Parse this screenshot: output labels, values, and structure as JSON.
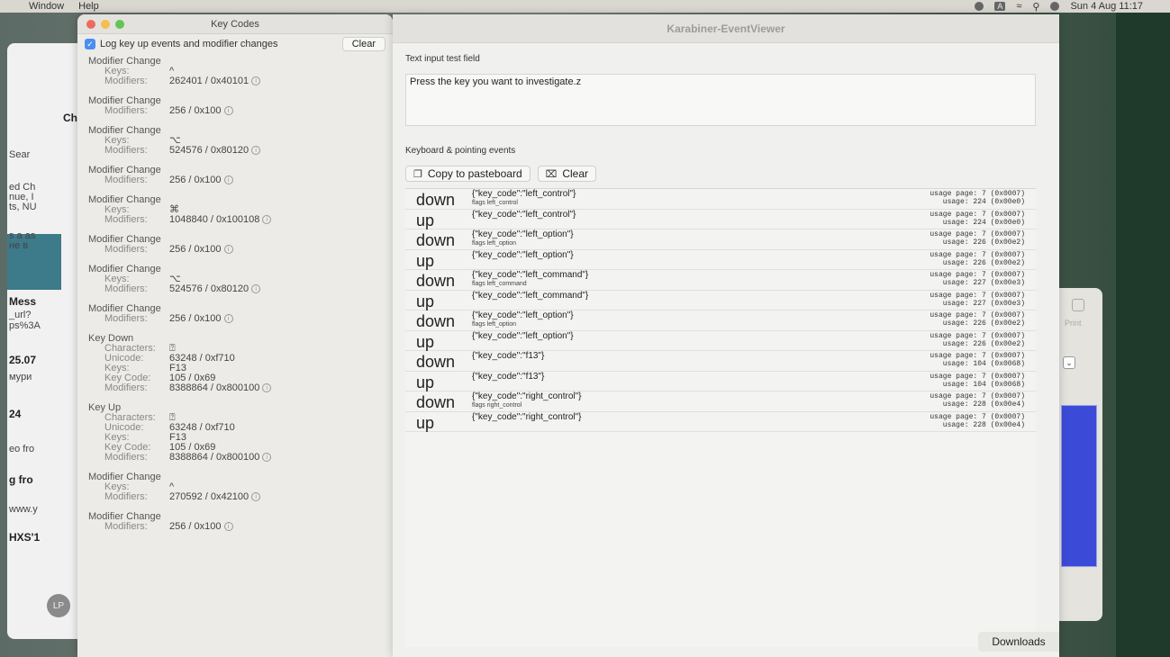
{
  "menubar": {
    "items": [
      "Window",
      "Help"
    ],
    "status_badge": "A",
    "datetime": "Sun 4 Aug 11:17"
  },
  "background_window": {
    "lines": [
      "Ch",
      "Sear",
      "ed Ch",
      "nue, I",
      "ts, NU",
      "s a as",
      "не в",
      "Mess",
      "_url?",
      "ps%3A",
      "25.07",
      "мури",
      "24",
      "eo fro",
      "g fro",
      "www.y",
      "HXS'1"
    ],
    "avatar": "LP"
  },
  "print_dialog": {
    "label": "Print"
  },
  "keycodes": {
    "title": "Key Codes",
    "log_checkbox_label": "Log key up events and modifier changes",
    "clear_label": "Clear",
    "entries": [
      {
        "title": "Modifier Change",
        "rows": [
          {
            "k": "Keys:",
            "v": "^"
          },
          {
            "k": "Modifiers:",
            "v": "262401 / 0x40101",
            "info": true
          }
        ]
      },
      {
        "title": "Modifier Change",
        "rows": [
          {
            "k": "Modifiers:",
            "v": "256 / 0x100",
            "info": true
          }
        ]
      },
      {
        "title": "Modifier Change",
        "rows": [
          {
            "k": "Keys:",
            "v": "⌥"
          },
          {
            "k": "Modifiers:",
            "v": "524576 / 0x80120",
            "info": true
          }
        ]
      },
      {
        "title": "Modifier Change",
        "rows": [
          {
            "k": "Modifiers:",
            "v": "256 / 0x100",
            "info": true
          }
        ]
      },
      {
        "title": "Modifier Change",
        "rows": [
          {
            "k": "Keys:",
            "v": "⌘"
          },
          {
            "k": "Modifiers:",
            "v": "1048840 / 0x100108",
            "info": true
          }
        ]
      },
      {
        "title": "Modifier Change",
        "rows": [
          {
            "k": "Modifiers:",
            "v": "256 / 0x100",
            "info": true
          }
        ]
      },
      {
        "title": "Modifier Change",
        "rows": [
          {
            "k": "Keys:",
            "v": "⌥"
          },
          {
            "k": "Modifiers:",
            "v": "524576 / 0x80120",
            "info": true
          }
        ]
      },
      {
        "title": "Modifier Change",
        "rows": [
          {
            "k": "Modifiers:",
            "v": "256 / 0x100",
            "info": true
          }
        ]
      },
      {
        "title": "Key Down",
        "rows": [
          {
            "k": "Characters:",
            "v": "⍰"
          },
          {
            "k": "Unicode:",
            "v": "63248 / 0xf710"
          },
          {
            "k": "Keys:",
            "v": "F13"
          },
          {
            "k": "Key Code:",
            "v": "105 / 0x69"
          },
          {
            "k": "Modifiers:",
            "v": "8388864 / 0x800100",
            "info": true
          }
        ]
      },
      {
        "title": "Key Up",
        "rows": [
          {
            "k": "Characters:",
            "v": "⍰"
          },
          {
            "k": "Unicode:",
            "v": "63248 / 0xf710"
          },
          {
            "k": "Keys:",
            "v": "F13"
          },
          {
            "k": "Key Code:",
            "v": "105 / 0x69"
          },
          {
            "k": "Modifiers:",
            "v": "8388864 / 0x800100",
            "info": true
          }
        ]
      },
      {
        "title": "Modifier Change",
        "rows": [
          {
            "k": "Keys:",
            "v": "^"
          },
          {
            "k": "Modifiers:",
            "v": "270592 / 0x42100",
            "info": true
          }
        ]
      },
      {
        "title": "Modifier Change",
        "rows": [
          {
            "k": "Modifiers:",
            "v": "256 / 0x100",
            "info": true
          }
        ]
      }
    ]
  },
  "viewer": {
    "title": "Karabiner-EventViewer",
    "text_input_label": "Text input test field",
    "text_input_value": "Press the key you want to investigate.z",
    "events_label": "Keyboard & pointing events",
    "copy_label": "Copy to pasteboard",
    "clear_label": "Clear",
    "events": [
      {
        "type": "down",
        "code": "{\"key_code\":\"left_control\"}",
        "flags": "flags left_control",
        "usage_page": "usage page: 7  (0x0007)",
        "usage": "usage: 224  (0x00e0)"
      },
      {
        "type": "up",
        "code": "{\"key_code\":\"left_control\"}",
        "flags": "",
        "usage_page": "usage page: 7  (0x0007)",
        "usage": "usage: 224  (0x00e0)"
      },
      {
        "type": "down",
        "code": "{\"key_code\":\"left_option\"}",
        "flags": "flags left_option",
        "usage_page": "usage page: 7  (0x0007)",
        "usage": "usage: 226  (0x00e2)"
      },
      {
        "type": "up",
        "code": "{\"key_code\":\"left_option\"}",
        "flags": "",
        "usage_page": "usage page: 7  (0x0007)",
        "usage": "usage: 226  (0x00e2)"
      },
      {
        "type": "down",
        "code": "{\"key_code\":\"left_command\"}",
        "flags": "flags left_command",
        "usage_page": "usage page: 7  (0x0007)",
        "usage": "usage: 227  (0x00e3)"
      },
      {
        "type": "up",
        "code": "{\"key_code\":\"left_command\"}",
        "flags": "",
        "usage_page": "usage page: 7  (0x0007)",
        "usage": "usage: 227  (0x00e3)"
      },
      {
        "type": "down",
        "code": "{\"key_code\":\"left_option\"}",
        "flags": "flags left_option",
        "usage_page": "usage page: 7  (0x0007)",
        "usage": "usage: 226  (0x00e2)"
      },
      {
        "type": "up",
        "code": "{\"key_code\":\"left_option\"}",
        "flags": "",
        "usage_page": "usage page: 7  (0x0007)",
        "usage": "usage: 226  (0x00e2)"
      },
      {
        "type": "down",
        "code": "{\"key_code\":\"f13\"}",
        "flags": "",
        "usage_page": "usage page: 7  (0x0007)",
        "usage": "usage: 104  (0x0068)"
      },
      {
        "type": "up",
        "code": "{\"key_code\":\"f13\"}",
        "flags": "",
        "usage_page": "usage page: 7  (0x0007)",
        "usage": "usage: 104  (0x0068)"
      },
      {
        "type": "down",
        "code": "{\"key_code\":\"right_control\"}",
        "flags": "flags right_control",
        "usage_page": "usage page: 7  (0x0007)",
        "usage": "usage: 228  (0x00e4)"
      },
      {
        "type": "up",
        "code": "{\"key_code\":\"right_control\"}",
        "flags": "",
        "usage_page": "usage page: 7  (0x0007)",
        "usage": "usage: 228  (0x00e4)"
      }
    ],
    "downloads_label": "Downloads"
  }
}
